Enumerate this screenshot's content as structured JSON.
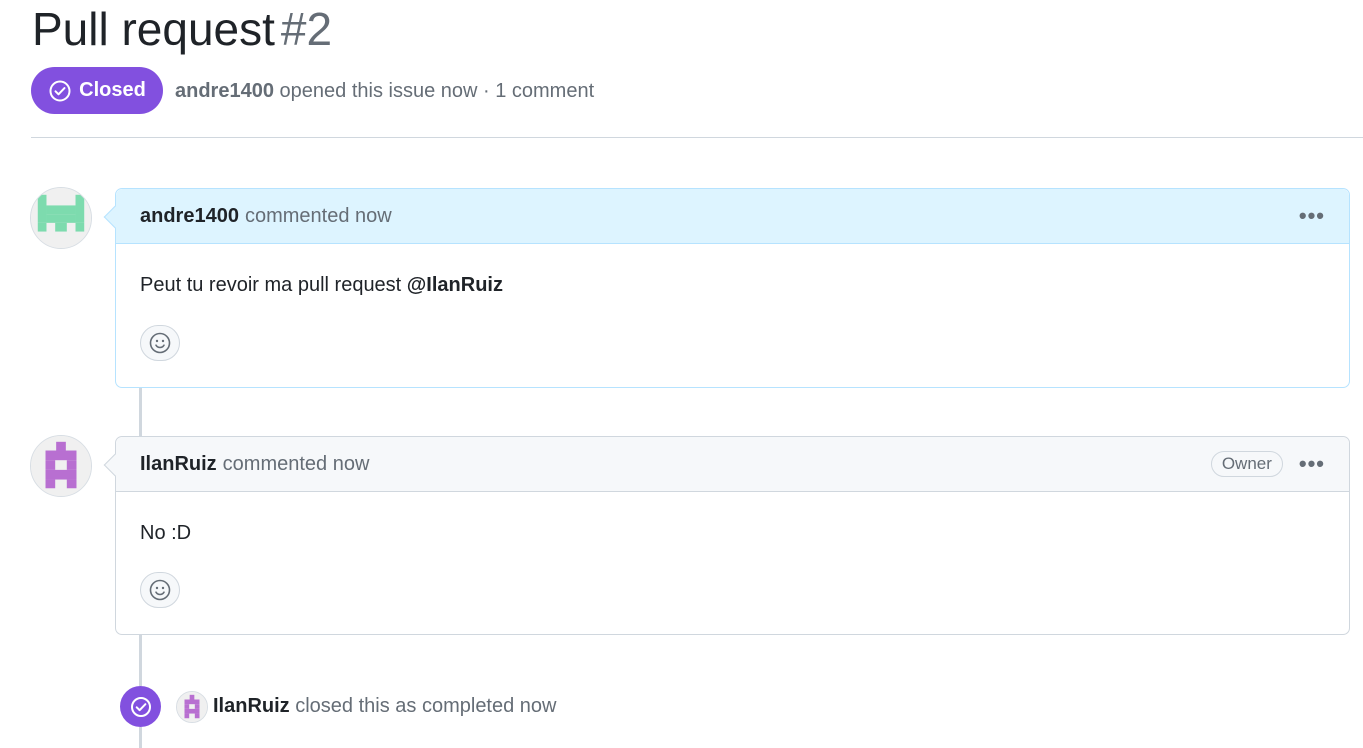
{
  "header": {
    "title": "Pull request",
    "number": "#2",
    "status_label": "Closed",
    "status_color": "#8250df",
    "author": "andre1400",
    "meta_text": "opened this issue now · 1 comment"
  },
  "comments": [
    {
      "author": "andre1400",
      "action": "commented now",
      "body_text": "Peut tu revoir ma pull request ",
      "mention": "@IlanRuiz",
      "avatar_icon": "identicon-green",
      "badge": "",
      "menu_icon": "kebab-horizontal-icon",
      "reaction_icon": "smiley-icon"
    },
    {
      "author": "IlanRuiz",
      "action": "commented now",
      "body_text": "No :D",
      "mention": "",
      "avatar_icon": "identicon-purple",
      "badge": "Owner",
      "menu_icon": "kebab-horizontal-icon",
      "reaction_icon": "smiley-icon"
    }
  ],
  "event": {
    "icon": "check-circle-icon",
    "actor": "IlanRuiz",
    "text": "closed this as completed now",
    "color": "#8250df"
  },
  "menu_dots": "•••"
}
